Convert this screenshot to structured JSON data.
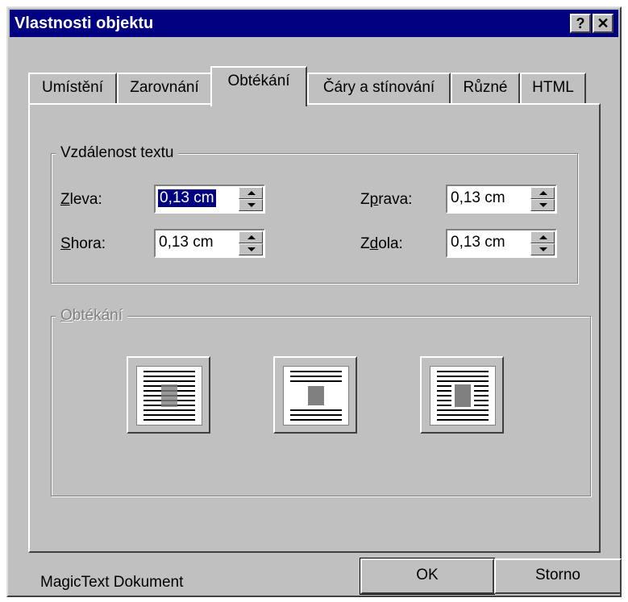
{
  "window": {
    "title": "Vlastnosti objektu",
    "help_label": "?",
    "close_label": "✕"
  },
  "tabs": [
    {
      "label": "Umístění"
    },
    {
      "label": "Zarovnání"
    },
    {
      "label": "Obtékání",
      "active": true
    },
    {
      "label": "Čáry a stínování"
    },
    {
      "label": "Různé"
    },
    {
      "label": "HTML"
    }
  ],
  "distance_group": {
    "legend": "Vzdálenost textu",
    "left": {
      "label_key": "Z",
      "label_rest": "leva:",
      "value": "0,13 cm"
    },
    "top": {
      "label_key": "S",
      "label_rest": "hora:",
      "value": "0,13 cm"
    },
    "right": {
      "label_pre": "Z",
      "label_key": "p",
      "label_rest": "rava:",
      "value": "0,13 cm"
    },
    "bottom": {
      "label_pre": "Z",
      "label_key": "d",
      "label_rest": "ola:",
      "value": "0,13 cm"
    }
  },
  "wrap_group": {
    "legend_key": "O",
    "legend_rest": "btékání",
    "options": [
      "wrap-inline-icon",
      "wrap-top-bottom-icon",
      "wrap-square-icon"
    ]
  },
  "footer": {
    "status": "MagicText Dokument",
    "ok_label": "OK",
    "cancel_label": "Storno"
  },
  "colors": {
    "face": "#c0c0c0",
    "titlebar": "#000080",
    "selection": "#000080"
  }
}
